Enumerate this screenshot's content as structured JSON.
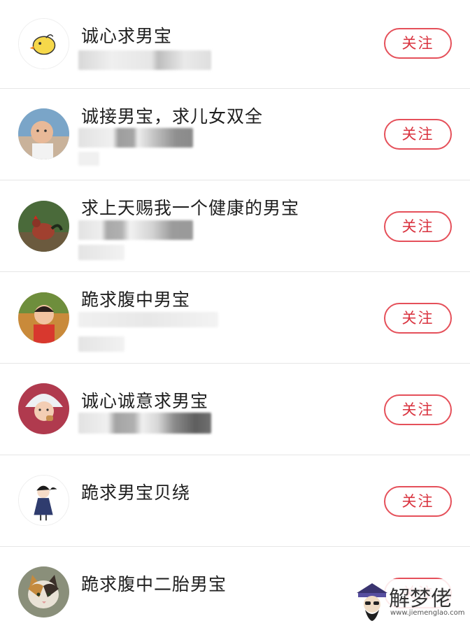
{
  "follow_label": "关注",
  "items": [
    {
      "title": "诚心求男宝",
      "avatar": "chick-cartoon"
    },
    {
      "title": "诚接男宝，求儿女双全",
      "avatar": "baby-photo"
    },
    {
      "title": "求上天赐我一个健康的男宝",
      "avatar": "rooster-photo"
    },
    {
      "title": "跪求腹中男宝",
      "avatar": "toddler-photo"
    },
    {
      "title": "诚心诚意求男宝",
      "avatar": "baby-hat-photo"
    },
    {
      "title": "跪求男宝贝绕",
      "avatar": "girl-cartoon"
    },
    {
      "title": "跪求腹中二胎男宝",
      "avatar": "cat-photo"
    }
  ],
  "watermark": {
    "name": "解梦佬",
    "url": "www.jiemenglao.com"
  },
  "colors": {
    "accent": "#d9333f",
    "border": "#e5505a",
    "divider": "#e6e6e6"
  }
}
